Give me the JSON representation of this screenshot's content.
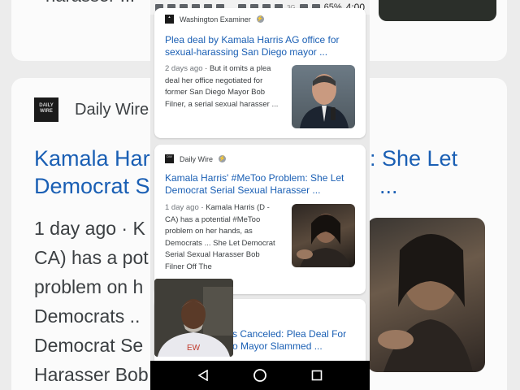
{
  "statusbar": {
    "network": "3G",
    "battery": "65%",
    "time": "4:00"
  },
  "background": {
    "top_snippet": "harasser ...",
    "source_name": "Daily Wire",
    "logo_text": "DAILY WIRE",
    "title_left": "Kamala Har",
    "title_left_2": "Democrat S",
    "title_right": ": She Let",
    "title_right_2": "...",
    "body_lines": [
      "1 day ago · K",
      "CA) has a pot",
      "problem on h",
      "Democrats ..",
      "Democrat Se",
      "Harasser Bob"
    ]
  },
  "cards": [
    {
      "source": "Washington Examiner",
      "title": "Plea deal by Kamala Harris AG office for sexual-harassing San Diego mayor ...",
      "age": "2 days ago",
      "snippet": "But it omits a plea deal her office negotiated for former San Diego Mayor Bob Filner, a serial sexual harasser ..."
    },
    {
      "source": "Daily Wire",
      "title": "Kamala Harris' #MeToo Problem: She Let Democrat Serial Sexual Harasser ...",
      "age": "1 day ago",
      "snippet": "Kamala Harris (D - CA) has a potential #MeToo problem on her hands, as Democrats ... She Let Democrat Serial Sexual Harasser Bob Filner Off The"
    },
    {
      "title": "s Canceled: Plea Deal For o Mayor Slammed ..."
    }
  ],
  "icons": {
    "amp": "amp-icon",
    "back": "back-icon",
    "home": "home-icon",
    "recents": "recents-icon"
  }
}
